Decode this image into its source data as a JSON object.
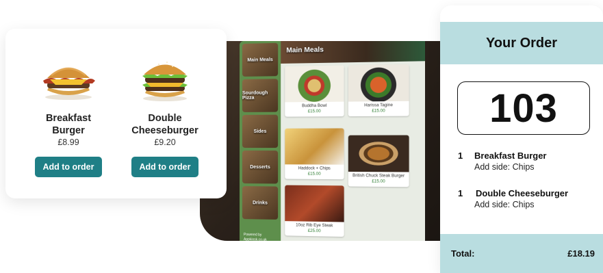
{
  "menu": {
    "products": [
      {
        "name_line1": "Breakfast",
        "name_line2": "Burger",
        "price": "£8.99",
        "button_label": "Add to order"
      },
      {
        "name_line1": "Double",
        "name_line2": "Cheeseburger",
        "price": "£9.20",
        "button_label": "Add to order"
      }
    ]
  },
  "kiosk": {
    "banner_title": "Main Meals",
    "categories": [
      "Main Meals",
      "Sourdough Pizza",
      "Sides",
      "Desserts",
      "Drinks"
    ],
    "powered_by": "Powered by Appkiosk.co.uk",
    "items": [
      {
        "name": "Buddha Bowl",
        "price": "£15.00"
      },
      {
        "name": "Harissa Tagine",
        "price": "£15.00"
      },
      {
        "name": "Haddock + Chips",
        "price": "£15.00"
      },
      {
        "name": "British Chuck Steak Burger",
        "price": "£15.00"
      },
      {
        "name": "10oz Rib Eye Steak",
        "price": "£25.00"
      }
    ]
  },
  "order": {
    "title": "Your Order",
    "number": "103",
    "items": [
      {
        "qty": "1",
        "name": "Breakfast Burger",
        "side": "Add side: Chips"
      },
      {
        "qty": "1",
        "name": "Double Cheeseburger",
        "side": "Add side: Chips"
      }
    ],
    "total_label": "Total:",
    "total_value": "£18.19"
  },
  "colors": {
    "accent_button": "#1f7f86",
    "order_panel_band": "#b9dde0",
    "kiosk_sidebar": "#5e8f4c"
  }
}
